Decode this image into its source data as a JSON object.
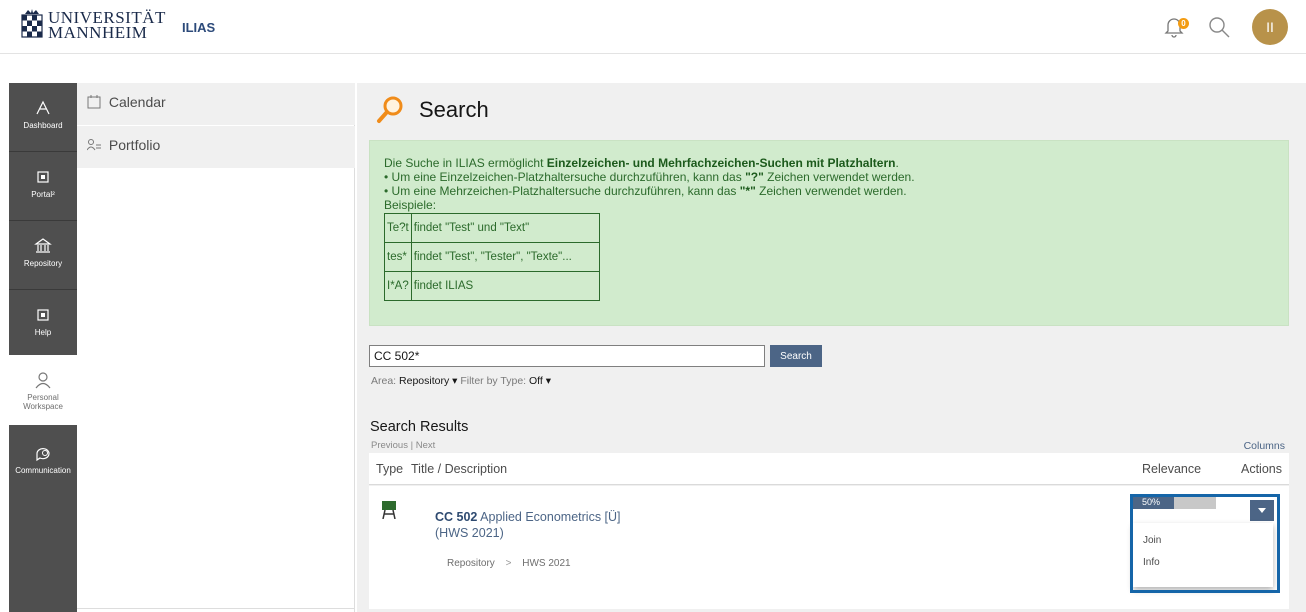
{
  "header": {
    "logo_line1": "UNIVERSITÄT",
    "logo_line2": "MANNHEIM",
    "app_name": "ILIAS",
    "notification_count": "0",
    "avatar_initials": "II"
  },
  "mainbar": {
    "items": [
      {
        "label": "Dashboard",
        "icon": "dashboard-icon"
      },
      {
        "label": "Portal²",
        "icon": "portal-icon"
      },
      {
        "label": "Repository",
        "icon": "repository-icon"
      },
      {
        "label": "Help",
        "icon": "help-icon"
      },
      {
        "label": "Personal Workspace",
        "icon": "personal-workspace-icon"
      },
      {
        "label": "Communication",
        "icon": "communication-icon"
      }
    ]
  },
  "slate": {
    "items": [
      {
        "label": "Calendar",
        "icon": "calendar-icon"
      },
      {
        "label": "Portfolio",
        "icon": "portfolio-icon"
      }
    ]
  },
  "page": {
    "title": "Search"
  },
  "info": {
    "intro_prefix": "Die Suche in ILIAS ermöglicht ",
    "intro_bold": "Einzelzeichen- und Mehrfachzeichen-Suchen mit Platzhaltern",
    "intro_suffix": ".",
    "line1_prefix": "• Um eine Einzelzeichen-Platzhaltersuche durchzuführen, kann das ",
    "line1_bold": "\"?\"",
    "line1_suffix": " Zeichen verwendet werden.",
    "line2_prefix": "• Um eine Mehrzeichen-Platzhaltersuche durchzuführen, kann das ",
    "line2_bold": "\"*\"",
    "line2_suffix": " Zeichen verwendet werden.",
    "examples_label": "Beispiele:",
    "examples": [
      {
        "pattern": "Te?t",
        "result": "findet \"Test\" und \"Text\""
      },
      {
        "pattern": "tes*",
        "result": "findet \"Test\", \"Tester\", \"Texte\"..."
      },
      {
        "pattern": "I*A?",
        "result": "findet ILIAS"
      }
    ]
  },
  "search": {
    "query": "CC 502*",
    "button_label": "Search",
    "area_label": "Area:",
    "area_value": "Repository",
    "filter_label": "Filter by Type:",
    "filter_value": "Off"
  },
  "results": {
    "title": "Search Results",
    "previous": "Previous",
    "next": "Next",
    "pager_sep": "|",
    "columns": "Columns",
    "headers": {
      "type": "Type",
      "title": "Title / Description",
      "relevance": "Relevance",
      "actions": "Actions"
    },
    "rows": [
      {
        "title_bold": "CC 502",
        "title_rest": " Applied Econometrics [Ü]",
        "subtitle": "(HWS 2021)",
        "crumb1": "Repository",
        "crumb_sep": ">",
        "crumb2": "HWS 2021",
        "relevance_label": "50%",
        "relevance": 0.5,
        "actions": [
          "Join",
          "Info"
        ]
      }
    ]
  },
  "colors": {
    "accent": "#4c6586",
    "info_bg": "#d1ebcd",
    "highlight_frame": "#1565a8",
    "avatar_bg": "#b8924a",
    "badge": "#f39c12",
    "mainbar_bg": "#4f4f4f"
  }
}
